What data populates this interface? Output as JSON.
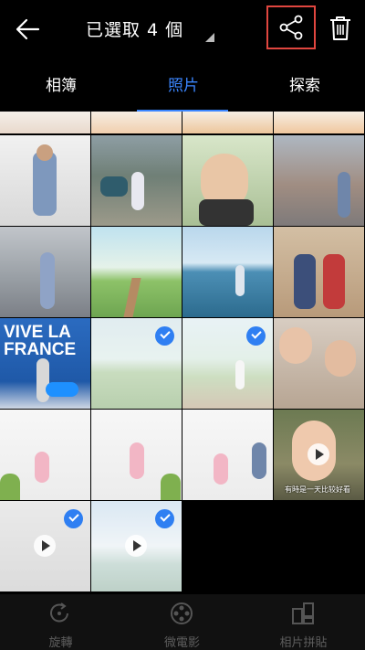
{
  "header": {
    "title": "已選取 4 個"
  },
  "tabs": [
    {
      "label": "相簿"
    },
    {
      "label": "照片",
      "active": true
    },
    {
      "label": "探索"
    }
  ],
  "grid": {
    "photos": [
      {
        "type": "photo",
        "selected": false
      },
      {
        "type": "photo",
        "selected": false
      },
      {
        "type": "photo",
        "selected": false
      },
      {
        "type": "photo",
        "selected": false
      },
      {
        "type": "photo",
        "selected": false
      },
      {
        "type": "photo",
        "selected": false
      },
      {
        "type": "photo",
        "selected": false
      },
      {
        "type": "photo",
        "selected": false
      },
      {
        "type": "photo",
        "selected": false
      },
      {
        "type": "photo",
        "selected": false
      },
      {
        "type": "photo",
        "selected": false
      },
      {
        "type": "photo",
        "selected": false
      },
      {
        "type": "photo",
        "selected": false,
        "overlay_text": [
          "VIVE LA",
          "FRANCE"
        ]
      },
      {
        "type": "photo",
        "selected": true
      },
      {
        "type": "photo",
        "selected": true
      },
      {
        "type": "photo",
        "selected": false
      },
      {
        "type": "photo",
        "selected": false
      },
      {
        "type": "photo",
        "selected": false
      },
      {
        "type": "photo",
        "selected": false
      },
      {
        "type": "video",
        "selected": false,
        "caption": "有時是一天比较好看"
      },
      {
        "type": "video",
        "selected": true
      },
      {
        "type": "video",
        "selected": true
      }
    ]
  },
  "bottom_bar": {
    "items": [
      {
        "label": "旋轉",
        "icon": "rotate-icon"
      },
      {
        "label": "微電影",
        "icon": "film-reel-icon"
      },
      {
        "label": "相片拼貼",
        "icon": "collage-icon"
      }
    ]
  },
  "colors": {
    "accent": "#3b86ff",
    "highlight_border": "#e0463f",
    "check": "#2f7ff2"
  }
}
